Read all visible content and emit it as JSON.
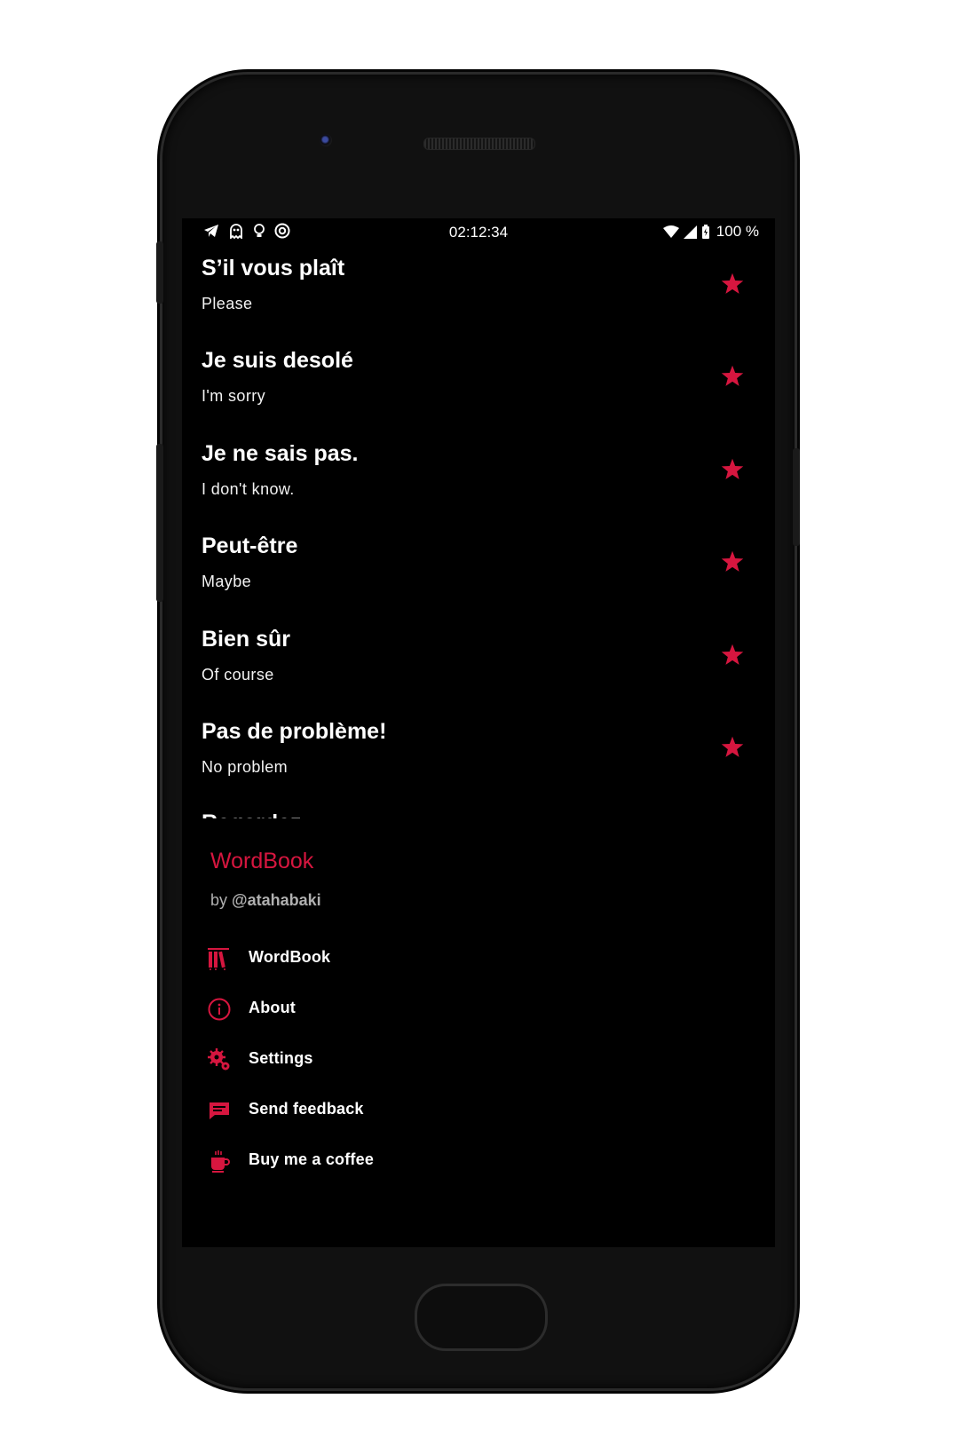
{
  "status_bar": {
    "time": "02:12:34",
    "battery": "100 %",
    "notification_icons": [
      "telegram-icon",
      "ghost-icon",
      "bulb-icon",
      "vpn-icon"
    ],
    "system_icons": [
      "wifi-icon",
      "signal-icon",
      "battery-icon"
    ]
  },
  "phrases": [
    {
      "phrase": "S’il vous plaît",
      "translation": "Please",
      "favorite": true
    },
    {
      "phrase": "Je suis desolé",
      "translation": "I'm sorry",
      "favorite": true
    },
    {
      "phrase": "Je ne sais pas.",
      "translation": "I don't know.",
      "favorite": true
    },
    {
      "phrase": "Peut-être",
      "translation": "Maybe",
      "favorite": true
    },
    {
      "phrase": "Bien sûr",
      "translation": "Of course",
      "favorite": true
    },
    {
      "phrase": "Pas de problème!",
      "translation": "No problem",
      "favorite": true
    },
    {
      "phrase": "Regardez",
      "translation": "",
      "favorite": true
    }
  ],
  "drawer": {
    "app_name": "WordBook",
    "author_prefix": "by",
    "author_handle": "@atahabaki",
    "menu": [
      {
        "label": "WordBook",
        "icon": "books-icon"
      },
      {
        "label": "About",
        "icon": "info-icon"
      },
      {
        "label": "Settings",
        "icon": "gears-icon"
      },
      {
        "label": "Send feedback",
        "icon": "feedback-icon"
      },
      {
        "label": "Buy me a coffee",
        "icon": "coffee-icon"
      }
    ]
  },
  "colors": {
    "accent": "#d6163f",
    "background": "#000000",
    "text": "#ffffff"
  }
}
